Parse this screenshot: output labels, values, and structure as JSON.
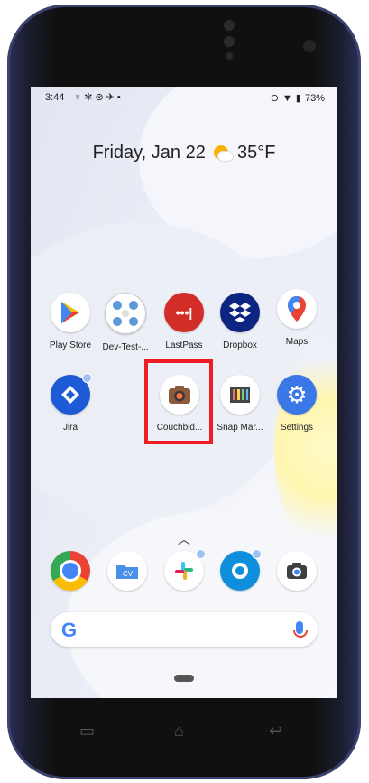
{
  "status_bar": {
    "time": "3:44",
    "battery": "73%"
  },
  "widget": {
    "date": "Friday, Jan 22",
    "temperature": "35°F"
  },
  "apps_row1": [
    {
      "name": "Play Store"
    },
    {
      "name": "Dev-Test-..."
    },
    {
      "name": "LastPass"
    },
    {
      "name": "Dropbox"
    },
    {
      "name": "Maps"
    }
  ],
  "apps_row2": [
    {
      "name": "Jira"
    },
    {
      "name": "Couchbid..."
    },
    {
      "name": "Snap Mar..."
    },
    {
      "name": "Settings"
    }
  ],
  "colors": {
    "highlight": "#ee1c24",
    "lastpass": "#d32d27",
    "dropbox": "#0d2481",
    "jira": "#1d5bd6",
    "settings": "#3b78e7"
  }
}
